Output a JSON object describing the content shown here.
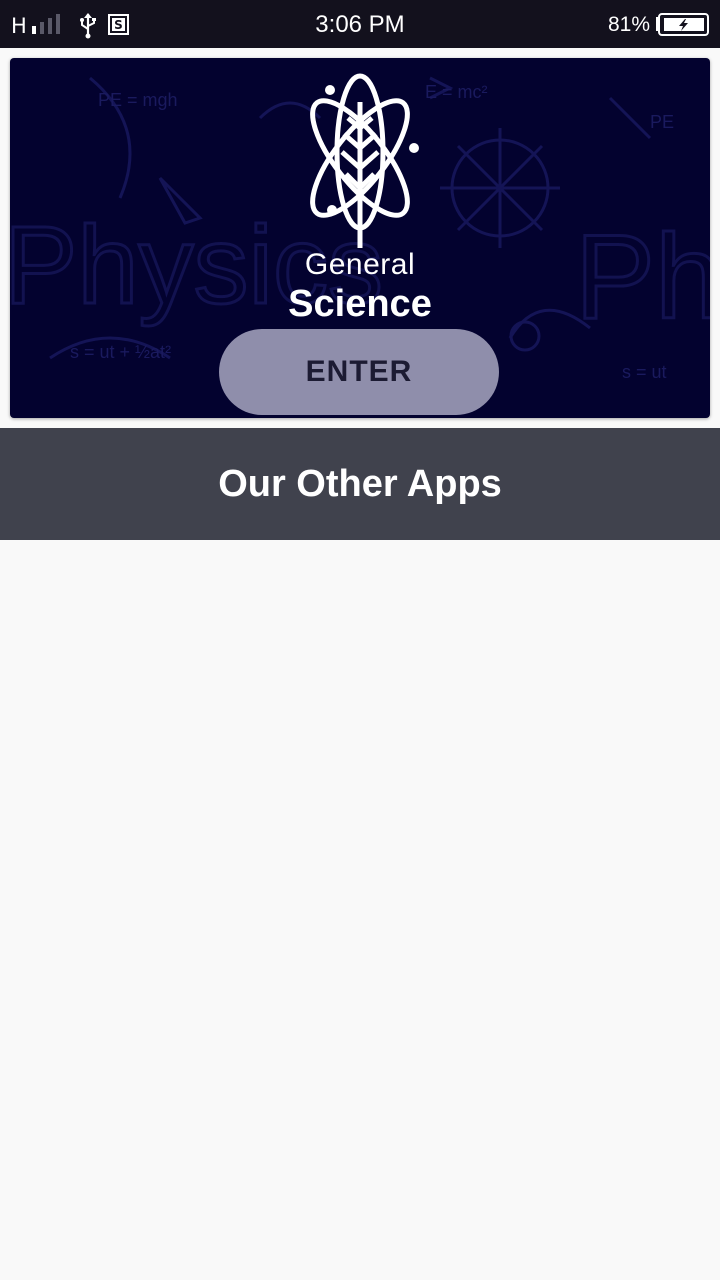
{
  "status_bar": {
    "network": "H",
    "time": "3:06 PM",
    "battery": "81%",
    "icons": [
      "signal-icon",
      "usb-icon",
      "s-app-icon",
      "battery-charging-icon"
    ]
  },
  "banner": {
    "logo_line1": "General",
    "logo_line2": "Science",
    "background_word": "Physics",
    "enter_label": "ENTER",
    "colors": {
      "background": "#03022f",
      "button": "#8f8eab"
    }
  },
  "other_apps": {
    "title": "Our Other Apps",
    "colors": {
      "header_bg": "#40424d",
      "page_bg": "#f9f9f9"
    }
  }
}
